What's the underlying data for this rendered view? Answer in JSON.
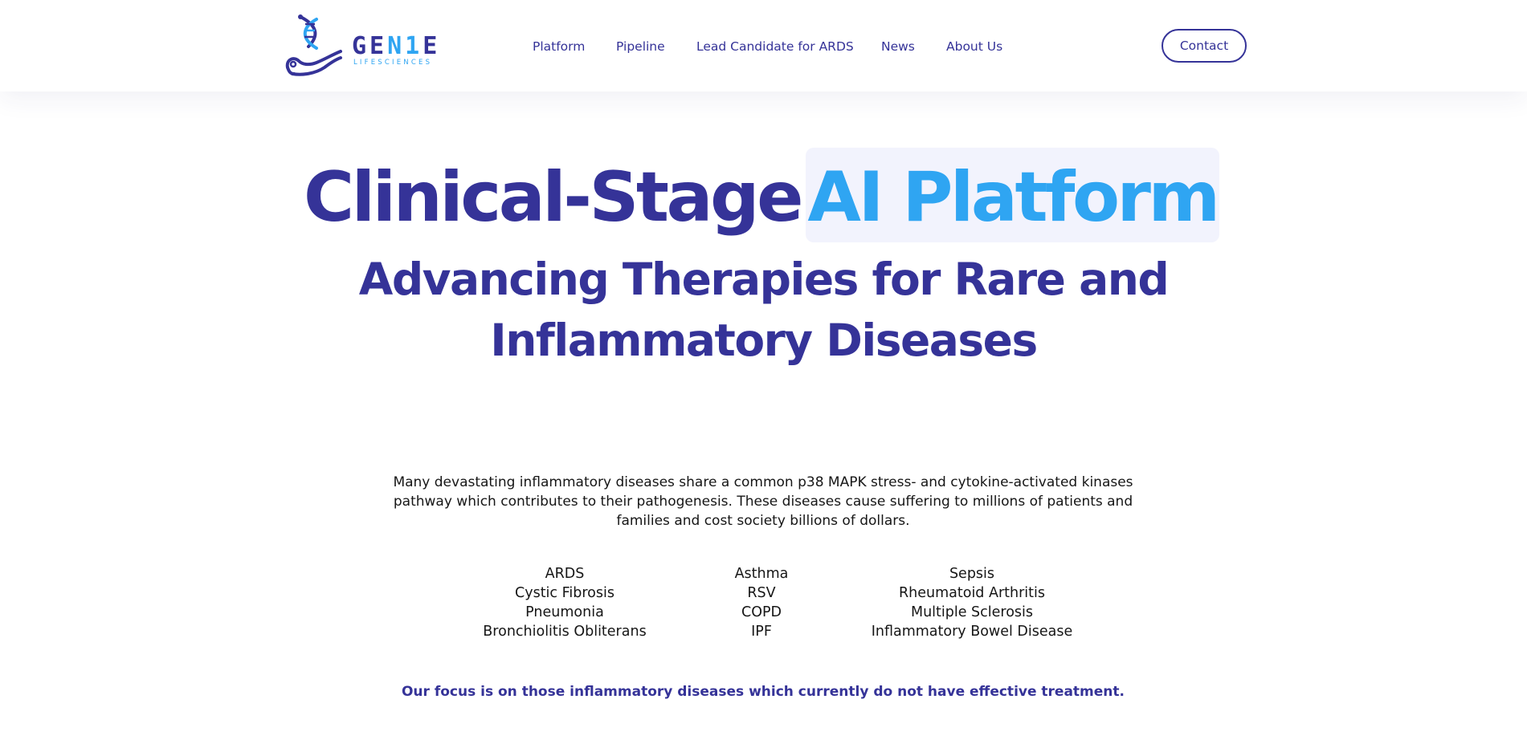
{
  "brand": {
    "word_prefix": "GE",
    "word_accent": "N1",
    "word_suffix": "E",
    "sub": "LIFESCIENCES",
    "colors": {
      "primary": "#353398",
      "accent": "#2fa5f2"
    }
  },
  "nav": {
    "items": [
      {
        "label": "Platform"
      },
      {
        "label": "Pipeline"
      },
      {
        "label": "Lead Candidate for ARDS"
      },
      {
        "label": "News"
      },
      {
        "label": "About Us"
      }
    ],
    "contact_label": "Contact"
  },
  "hero": {
    "title_left": "Clinical-Stage",
    "title_highlight": "AI Platform",
    "subtitle": "Advancing Therapies for Rare and Inflammatory Diseases"
  },
  "intro": {
    "text": "Many devastating inflammatory diseases share a common p38 MAPK stress- and cytokine-activated kinases pathway which contributes to their pathogenesis. These diseases cause suffering to millions of patients and families and cost society billions of dollars."
  },
  "diseases": {
    "columns": [
      [
        "ARDS",
        "Cystic Fibrosis",
        "Pneumonia",
        "Bronchiolitis Obliterans"
      ],
      [
        "Asthma",
        "RSV",
        "COPD",
        "IPF"
      ],
      [
        "Sepsis",
        "Rheumatoid Arthritis",
        "Multiple Sclerosis",
        "Inflammatory Bowel Disease"
      ]
    ]
  },
  "focus": {
    "text": "Our focus is on those inflammatory diseases which currently do not have effective treatment."
  }
}
